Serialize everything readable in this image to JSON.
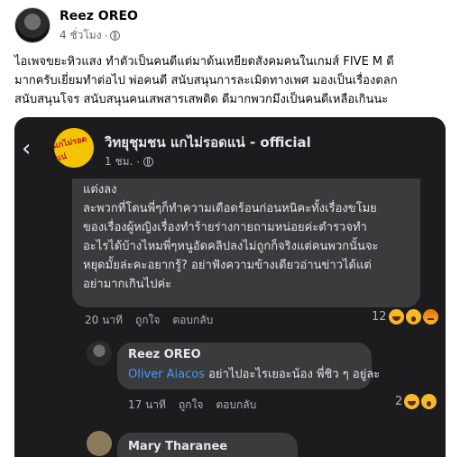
{
  "post": {
    "author": "Reez OREO",
    "time": "4 ชั่วโมง",
    "separator": "·",
    "text": "ไอเพจขยะหิวแสง ทำตัวเป็นคนดีแต่มาด้นเหยียดสังคมคนในเกมส์ FIVE M ดี\nมากครับเยี่ยมทำต่อไป พ่อคนดี สนับสนุนการละเมิดทางเพศ มองเป็นเรื่องตลก\nสนับสนุนโจร สนับสนุนคนเสพสารเสพติด ดีมากพวกมึงเป็นคนดีเหลือเกินนะ"
  },
  "screenshot": {
    "page_name": "วิทยุชุมชน แกไม่รอดแน่ - official",
    "page_time": "1 ชม.",
    "page_separator": "·",
    "page_logo_text": "แกไม่รอดแน่",
    "comment1": {
      "text": "แต่งลง\nละพวกที่โดนพี่ๆก็ทำความเดือดร้อนก่อนหนิคะทั้งเรื่องขโมย\nของเรื่องผู้หญิงเรื่องทำร้ายร่างกายถามหน่อยค่ะตำรวจทำ\nอะไรได้บ้างไหมพี่ๆหนูอัดคลิปลงไม่ถูกก็จริงแต่คนพวกนั้นจะ\nหยุดมั้ยล่ะคะอยากรู้? อย่าฟังความข้างเดียวอ่านข่าวได้แต่\nอย่ามากเกินไปค่ะ",
      "time": "20 นาที",
      "like": "ถูกใจ",
      "reply": "ตอบกลับ",
      "reaction_count": "12"
    },
    "comment2": {
      "author": "Reez OREO",
      "mention": "Oliver Aiacos",
      "text": " อย่าไปอะไรเยอะน้อง พี่ชิว ๆ อยู่ละ",
      "time": "17 นาที",
      "like": "ถูกใจ",
      "reply": "ตอบกลับ",
      "reaction_count": "2"
    },
    "comment3": {
      "author": "Mary Tharanee"
    }
  },
  "colors": {
    "dark_bg": "#1c1c1e",
    "bubble": "#3a3b3c",
    "mention": "#4599ff"
  }
}
